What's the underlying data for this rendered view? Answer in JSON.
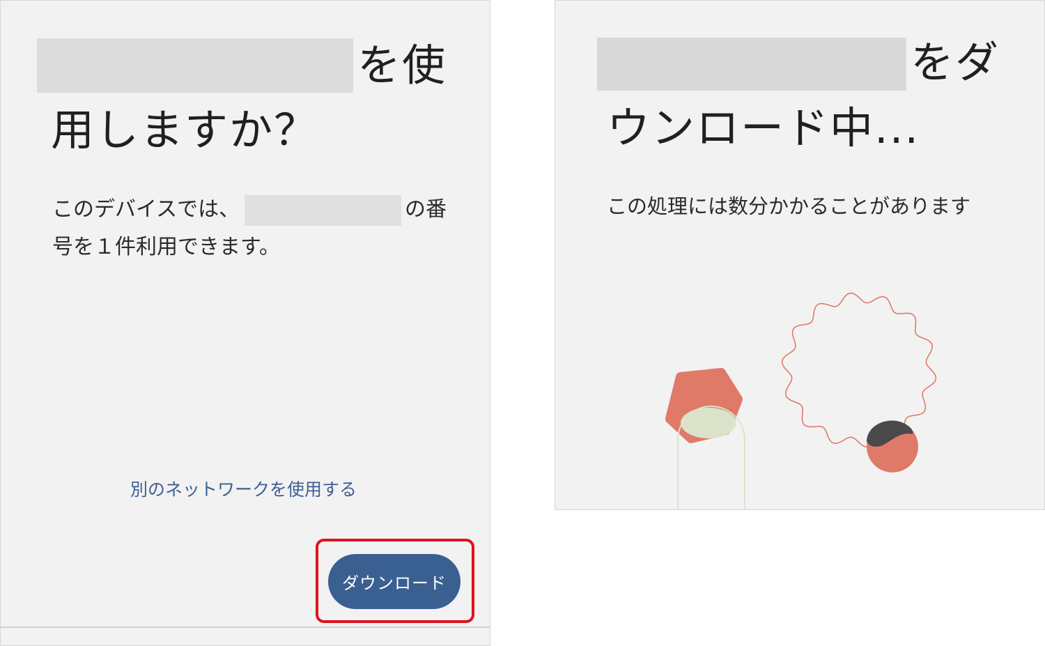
{
  "left_screen": {
    "title_suffix_line1": "を使",
    "title_line2": "用しますか？",
    "body_line1_prefix": "このデバイスでは、",
    "body_line1_suffix": "の番",
    "body_line2": "号を１件利用できます。",
    "alt_network_link": "別のネットワークを使用する",
    "download_button": "ダウンロード"
  },
  "right_screen": {
    "title_suffix_line1": "をダ",
    "title_line2": "ウンロード中...",
    "subtitle": "この処理には数分かかることがあります"
  },
  "colors": {
    "primary_button": "#3a5f91",
    "link": "#3d5f92",
    "highlight": "#e0121b",
    "accent_coral": "#e07a68",
    "accent_green": "#d9e8cf",
    "accent_dark": "#4a4a4a"
  }
}
